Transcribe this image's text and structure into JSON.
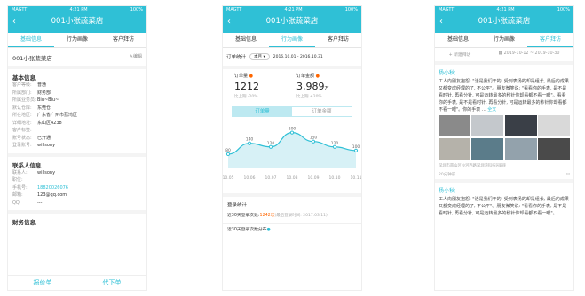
{
  "status": {
    "carrier": "MAGTT",
    "time": "4:21 PM",
    "battery": "100%"
  },
  "title": "001小张蔬菜店",
  "tabs": [
    "基础信息",
    "行为画像",
    "客户拜访"
  ],
  "p1": {
    "store": "001小张蔬菜店",
    "edit": "编辑",
    "basic_title": "基本信息",
    "basic": [
      [
        "客户等级:",
        "普通"
      ],
      [
        "所属部门:",
        "财务部"
      ],
      [
        "所属业务员:",
        "Biu~Biu~"
      ],
      [
        "默认仓库:",
        "东莞仓"
      ],
      [
        "所在地区:",
        "广东省广州市荔湾区"
      ],
      [
        "详细地址:",
        "东山区4238"
      ],
      [
        "客户标签:",
        ""
      ],
      [
        "账号状态:",
        "已开通"
      ],
      [
        "登录账号:",
        "willsony"
      ]
    ],
    "contact_title": "联系人信息",
    "contact": [
      [
        "联系人:",
        "willsony"
      ],
      [
        "职位:",
        ""
      ],
      [
        "手机号:",
        "18820026076"
      ],
      [
        "邮箱:",
        "123@qq.com"
      ],
      [
        "QQ:",
        "---"
      ]
    ],
    "finance_title": "财务信息",
    "footer": [
      "报价单",
      "代下单"
    ]
  },
  "p2": {
    "label": "订单统计",
    "range_btn": "本月",
    "dates": "2016.10.01 - 2016.10.31",
    "qty_label": "订单量",
    "qty_value": "1212",
    "qty_change": "比上期 -20%",
    "amt_label": "订单金额",
    "amt_value": "3,989",
    "amt_unit": "万",
    "amt_change": "比上期 +20%",
    "seg": [
      "订单量",
      "订单金额"
    ],
    "login_title": "登录统计",
    "login1_label": "近30天登录次数:",
    "login1_value": "1242次",
    "login1_note": "(最后登录时间: 2017.03.11)",
    "login2_label": "近30天登录次数分布"
  },
  "chart_data": {
    "type": "area",
    "categories": [
      "10.05",
      "10.06",
      "10.07",
      "10.08",
      "10.09",
      "10.10",
      "10.11"
    ],
    "values": [
      80,
      140,
      120,
      200,
      150,
      120,
      100
    ],
    "ylim": [
      0,
      260
    ]
  },
  "p3": {
    "new_visit": "新建拜访",
    "date_range": "2019-10-12 ~ 2019-10-30",
    "user1": "杨小秋",
    "post1": "工人向朋友抱怨: \"活是我们干的, 受到表扬的却是组长, 最后的成果又都变成经理的了, 不公平\"。朋友微笑说: \"看看你的手表, 是不是看时针, 再看分针, 可是运转最多的秒针你却看都不看一眼\"。看看你的手表, 是不是看时针, 再看分针, 可是运转最多的秒针你却看都不看一眼\"。你的手表 ...",
    "more": "全文",
    "location": "深圳市南山区沙河西路深圳湾科技园B座",
    "time": "20分钟前",
    "user2": "杨小秋",
    "post2": "工人向朋友抱怨: \"活是我们干的, 受到表扬的却是组长, 最后的成果又都变成经理的了, 不公平\"。朋友微笑说: \"看看你的手表, 是不是看时针, 再看分针, 可是运转最多的秒针你却看都不看一眼\"。"
  }
}
